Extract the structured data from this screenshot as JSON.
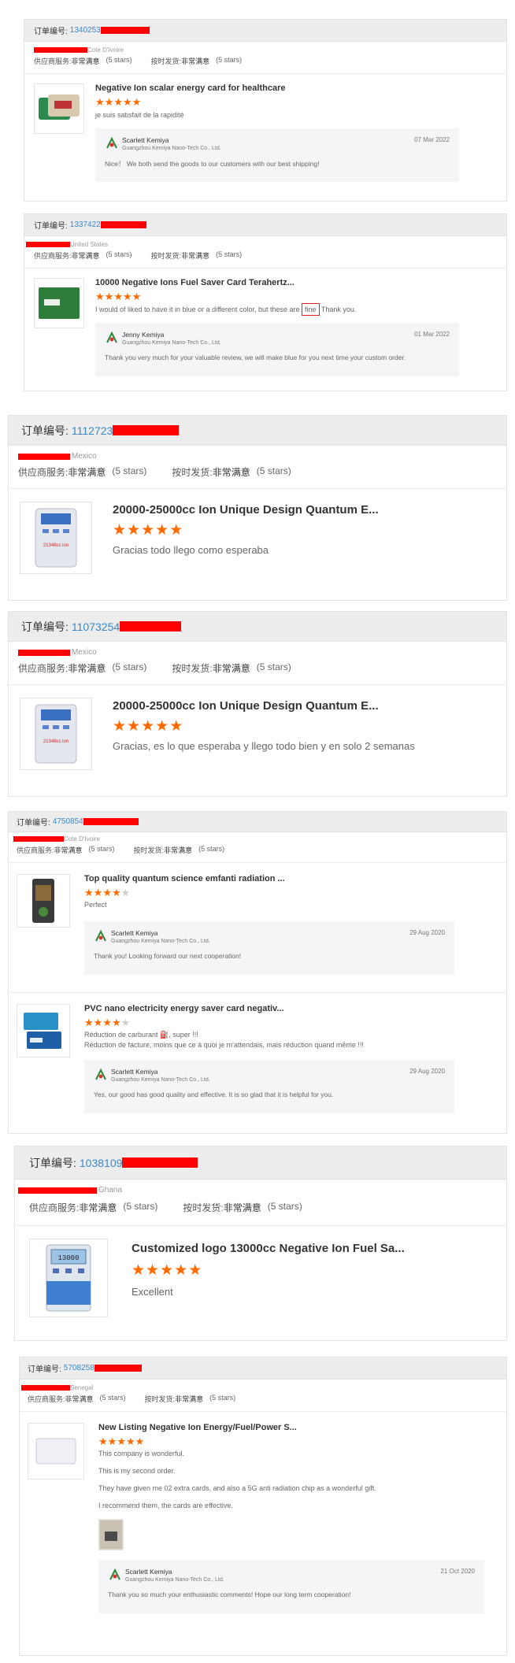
{
  "common": {
    "order_label": "订单编号:",
    "service_label": "供应商服务:",
    "service_value": "非常满意",
    "service_stars": "(5 stars)",
    "shipping_label": "按时发货:",
    "shipping_value": "非常满意",
    "shipping_stars": "(5 stars)"
  },
  "colors": {
    "star": "#ff6a00",
    "link": "#3a87c8",
    "redaction": "#ff0000",
    "header": "#ededed"
  },
  "cards": [
    {
      "order_number": "1340253",
      "country": "Cote D'Ivoire",
      "items": [
        {
          "title": "Negative Ion scalar energy card for healthcare",
          "rating": 5,
          "review": "je suis satisfait de la rapidité",
          "reply": {
            "name": "Scarlett Kemiya",
            "company": "Guangzhou Kemiya Nano-Tech Co., Ltd.",
            "date": "07 Mar 2022",
            "text": "Nice！ We both send the goods to our customers with our best shipping!"
          }
        }
      ]
    },
    {
      "order_number": "1337422",
      "country": "United States",
      "items": [
        {
          "title": "10000 Negative Ions Fuel Saver Card Terahertz...",
          "rating": 5,
          "review_pre": "I would of liked to have it in blue or a different color, but these are",
          "review_highlight": "fine",
          "review_post": "Thank you.",
          "reply": {
            "name": "Jenny Kemiya",
            "company": "Guangzhou Kemiya Nano-Tech Co., Ltd.",
            "date": "01 Mar 2022",
            "text": "Thank you very much for your valuable review, we will make blue for you next time your custom order."
          }
        }
      ]
    },
    {
      "order_number": "1112723",
      "country": "Mexico",
      "items": [
        {
          "title": "20000-25000cc Ion Unique Design Quantum E...",
          "rating": 5,
          "review": "Gracias todo llego como esperaba",
          "thumb_label": "21348cc ion"
        }
      ]
    },
    {
      "order_number": "11073254",
      "country": "Mexico",
      "items": [
        {
          "title": "20000-25000cc Ion Unique Design Quantum E...",
          "rating": 5,
          "review": "Gracias, es lo que esperaba y llego todo bien y en solo 2 semanas",
          "thumb_label": "21348cc ion"
        }
      ]
    },
    {
      "order_number": "4750854",
      "country": "Cote D'Ivoire",
      "items": [
        {
          "title": "Top quality quantum science emfanti radiation ...",
          "rating": 4,
          "review": "Perfect",
          "reply": {
            "name": "Scarlett Kemiya",
            "company": "Guangzhou Kemiya Nano-Tech Co., Ltd.",
            "date": "29 Aug 2020",
            "text": "Thank you! Looking forward our next cooperation!"
          }
        },
        {
          "title": "PVC nano electricity energy saver card negativ...",
          "rating": 4,
          "review_line1": "Réduction de carburant ⛽, super !!!",
          "review_line2": "Réduction de facture, moins que ce à quoi je m'attendais, mais réduction quand même !!!",
          "reply": {
            "name": "Scarlett Kemiya",
            "company": "Guangzhou Kemiya Nano-Tech Co., Ltd.",
            "date": "29 Aug 2020",
            "text": "Yes, our good has good quality and effective. It is so glad that it is helpful for you."
          }
        }
      ]
    },
    {
      "order_number": "1038109",
      "country": "Ghana",
      "items": [
        {
          "title": "Customized logo 13000cc Negative Ion Fuel Sa...",
          "rating": 5,
          "review": "Excellent",
          "thumb_label": "13000"
        }
      ]
    },
    {
      "order_number": "5708258",
      "country": "Senegal",
      "items": [
        {
          "title": "New Listing Negative Ion Energy/Fuel/Power S...",
          "rating": 5,
          "review_lines": [
            "This company is wonderful.",
            "This is my second order.",
            "They have given me 02 extra cards, and also a 5G anti radiation chip as a wonderful gift.",
            "I recommend them, the cards are effective."
          ],
          "reply": {
            "name": "Scarlett Kemiya",
            "company": "Guangzhou Kemiya Nano-Tech Co., Ltd.",
            "date": "21 Oct 2020",
            "text": "Thank you so much your enthusiastic comments! Hope our long term cooperation!"
          }
        }
      ]
    }
  ]
}
